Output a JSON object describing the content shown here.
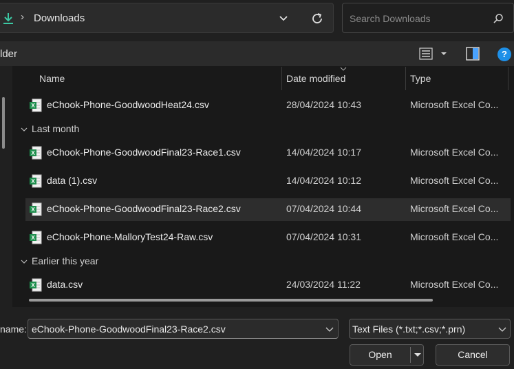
{
  "address": {
    "location": "Downloads"
  },
  "search": {
    "placeholder": "Search Downloads"
  },
  "toolbar": {
    "new_folder_label": "lder",
    "help_label": "?"
  },
  "columns": {
    "name": "Name",
    "date": "Date modified",
    "type": "Type"
  },
  "groups": {
    "last_month": "Last month",
    "earlier": "Earlier this year"
  },
  "files": [
    {
      "name": "eChook-Phone-GoodwoodHeat24.csv",
      "date": "28/04/2024 10:43",
      "type": "Microsoft Excel Co..."
    },
    {
      "name": "eChook-Phone-GoodwoodFinal23-Race1.csv",
      "date": "14/04/2024 10:17",
      "type": "Microsoft Excel Co..."
    },
    {
      "name": "data (1).csv",
      "date": "14/04/2024 10:12",
      "type": "Microsoft Excel Co..."
    },
    {
      "name": "eChook-Phone-GoodwoodFinal23-Race2.csv",
      "date": "07/04/2024 10:44",
      "type": "Microsoft Excel Co..."
    },
    {
      "name": "eChook-Phone-MalloryTest24-Raw.csv",
      "date": "07/04/2024 10:31",
      "type": "Microsoft Excel Co..."
    },
    {
      "name": "data.csv",
      "date": "24/03/2024 11:22",
      "type": "Microsoft Excel Co..."
    }
  ],
  "bottom": {
    "filename_label": "name:",
    "filename_value": "eChook-Phone-GoodwoodFinal23-Race2.csv",
    "filetype_value": "Text Files (*.txt;*.csv;*.prn)",
    "open_label": "Open",
    "cancel_label": "Cancel"
  },
  "colors": {
    "accent_download": "#3cc9a4",
    "excel_green": "#1f8f4e",
    "help_blue": "#1e90e8"
  }
}
